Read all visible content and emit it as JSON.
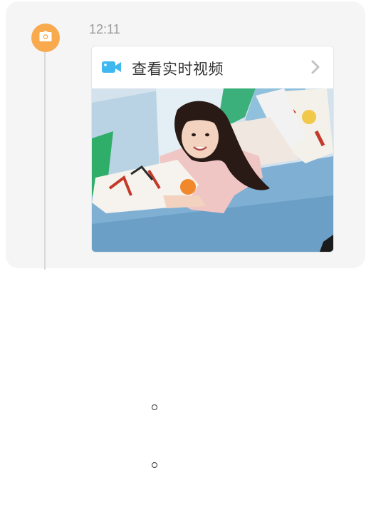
{
  "event": {
    "time": "12:11",
    "live_video_label": "查看实时视频",
    "icons": {
      "badge": "camera-icon",
      "video": "video-camera-icon",
      "chevron": "chevron-right-icon"
    },
    "snapshot": {
      "description_image": "camera-snapshot"
    }
  },
  "colors": {
    "badge": "#f9a94e",
    "video_icon": "#3fb8f0",
    "card_bg": "#f5f5f5"
  }
}
